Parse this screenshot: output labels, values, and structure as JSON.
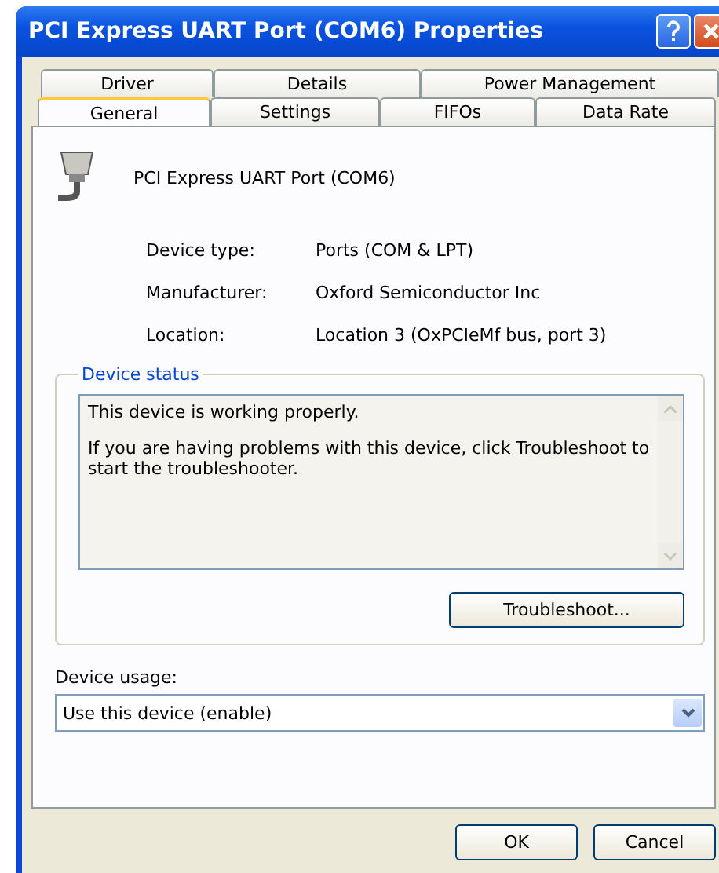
{
  "window": {
    "title": "PCI Express UART Port (COM6) Properties"
  },
  "tab_rows": [
    [
      {
        "label": "Driver",
        "selected": false
      },
      {
        "label": "Details",
        "selected": false
      },
      {
        "label": "Power Management",
        "selected": false
      }
    ],
    [
      {
        "label": "General",
        "selected": true
      },
      {
        "label": "Settings",
        "selected": false
      },
      {
        "label": "FIFOs",
        "selected": false
      },
      {
        "label": "Data Rate",
        "selected": false
      }
    ]
  ],
  "device_name": "PCI Express UART Port (COM6)",
  "properties": [
    {
      "label": "Device type:",
      "value": "Ports (COM & LPT)"
    },
    {
      "label": "Manufacturer:",
      "value": "Oxford Semiconductor Inc"
    },
    {
      "label": "Location:",
      "value": "Location 3 (OxPCIeMf bus, port 3)"
    }
  ],
  "device_status": {
    "legend": "Device status",
    "paragraphs": [
      "This device is working properly.",
      "If you are having problems with this device, click Troubleshoot to start the troubleshooter."
    ],
    "button": "Troubleshoot..."
  },
  "device_usage": {
    "label": "Device usage:",
    "value": "Use this device (enable)"
  },
  "buttons": [
    "OK",
    "Cancel"
  ]
}
